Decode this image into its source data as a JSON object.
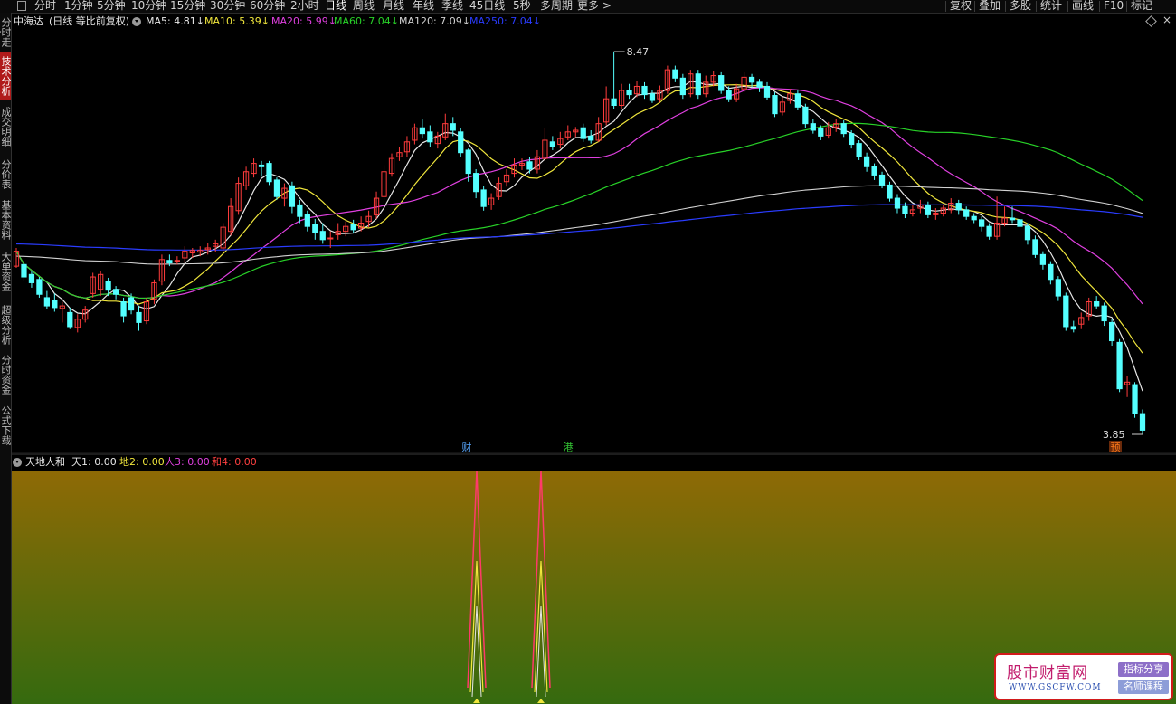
{
  "toolbar": {
    "timeframes": [
      "分时",
      "1分钟",
      "5分钟",
      "10分钟",
      "15分钟",
      "30分钟",
      "60分钟",
      "2小时",
      "日线",
      "周线",
      "月线",
      "年线",
      "季线",
      "45日线",
      "5秒",
      "多周期",
      "更多 >"
    ],
    "active": "日线",
    "right_buttons": [
      "复权",
      "叠加",
      "多股",
      "统计",
      "画线",
      "F10",
      "标记"
    ]
  },
  "left_tabs": [
    {
      "label": "分时走势",
      "selected": false
    },
    {
      "label": "技术分析",
      "selected": true
    },
    {
      "label": "成交明细",
      "selected": false
    },
    {
      "label": "分价表",
      "selected": false
    },
    {
      "label": "基本资料",
      "selected": false
    },
    {
      "label": "大单资金",
      "selected": false
    },
    {
      "label": "超级分析",
      "selected": false
    },
    {
      "label": "分时资金",
      "selected": false
    },
    {
      "label": "公式下载",
      "selected": false
    }
  ],
  "main_chart": {
    "stock": "中海达",
    "mode": "(日线 等比前复权)",
    "ma_legend": [
      {
        "label": "MA5: 4.81",
        "arrow": "↓",
        "color": "#e8e8e8"
      },
      {
        "label": "MA10: 5.39",
        "arrow": "↓",
        "color": "#f0e63c"
      },
      {
        "label": "MA20: 5.99",
        "arrow": "↓",
        "color": "#e040e0"
      },
      {
        "label": "MA60: 7.04",
        "arrow": "↓",
        "color": "#28d228"
      },
      {
        "label": "MA120: 7.09",
        "arrow": "↓",
        "color": "#d2d2d2"
      },
      {
        "label": "MA250: 7.04",
        "arrow": "↓",
        "color": "#2a3cff"
      }
    ],
    "high_label": "8.47",
    "low_label": "3.85",
    "markers": [
      {
        "text": "财",
        "color": "#58a8ff"
      },
      {
        "text": "港",
        "color": "#34c734"
      },
      {
        "text": "预",
        "color": "#ff7a1a"
      }
    ],
    "up_color": "#ff3c3c",
    "down_color": "#54ffff"
  },
  "indicator": {
    "name": "天地人和",
    "lines": [
      {
        "label": "天1: 0.00",
        "color": "#e8e8e8"
      },
      {
        "label": "地2: 0.00",
        "color": "#f0e63c"
      },
      {
        "label": "人3: 0.00",
        "color": "#e040e0"
      },
      {
        "label": "和4: 0.00",
        "color": "#ff4040"
      }
    ],
    "bg_top": "#8f6a05",
    "bg_bottom": "#356a0f",
    "spike_color": "#ff3a6a"
  },
  "watermark": {
    "main_text": "股市财富网",
    "url": "WWW.GSCFW.COM",
    "tag1": "指标分享",
    "tag2": "名师课程"
  },
  "chart_data": {
    "type": "candlestick",
    "price_range": [
      3.85,
      8.47
    ],
    "candles": [
      [
        5.88,
        6.06,
        6.1,
        5.86
      ],
      [
        5.9,
        5.75,
        5.95,
        5.7
      ],
      [
        5.78,
        5.68,
        5.82,
        5.62
      ],
      [
        5.72,
        5.54,
        5.75,
        5.5
      ],
      [
        5.5,
        5.4,
        5.58,
        5.36
      ],
      [
        5.47,
        5.38,
        5.55,
        5.33
      ],
      [
        5.37,
        5.4,
        5.45,
        5.2
      ],
      [
        5.32,
        5.15,
        5.38,
        5.12
      ],
      [
        5.14,
        5.24,
        5.3,
        5.08
      ],
      [
        5.24,
        5.35,
        5.4,
        5.2
      ],
      [
        5.55,
        5.75,
        5.8,
        5.5
      ],
      [
        5.6,
        5.78,
        5.82,
        5.52
      ],
      [
        5.7,
        5.59,
        5.74,
        5.52
      ],
      [
        5.6,
        5.54,
        5.64,
        5.48
      ],
      [
        5.45,
        5.28,
        5.5,
        5.2
      ],
      [
        5.5,
        5.35,
        5.55,
        5.3
      ],
      [
        5.32,
        5.2,
        5.4,
        5.1
      ],
      [
        5.22,
        5.45,
        5.5,
        5.18
      ],
      [
        5.48,
        5.68,
        5.72,
        5.42
      ],
      [
        5.7,
        5.96,
        6.02,
        5.65
      ],
      [
        5.95,
        5.92,
        6.02,
        5.88
      ],
      [
        5.94,
        5.95,
        6.0,
        5.9
      ],
      [
        5.98,
        6.06,
        6.12,
        5.92
      ],
      [
        6.04,
        6.07,
        6.1,
        5.98
      ],
      [
        6.05,
        6.07,
        6.12,
        6.0
      ],
      [
        6.08,
        6.1,
        6.16,
        6.02
      ],
      [
        6.12,
        6.15,
        6.2,
        6.05
      ],
      [
        6.1,
        6.35,
        6.4,
        6.05
      ],
      [
        6.3,
        6.6,
        6.7,
        6.25
      ],
      [
        6.55,
        6.88,
        6.95,
        6.5
      ],
      [
        6.85,
        7.02,
        7.08,
        6.8
      ],
      [
        7.0,
        7.12,
        7.18,
        6.95
      ],
      [
        7.1,
        7.08,
        7.15,
        6.96
      ],
      [
        7.12,
        6.9,
        7.15,
        6.86
      ],
      [
        6.92,
        6.72,
        6.95,
        6.68
      ],
      [
        6.7,
        6.82,
        6.88,
        6.6
      ],
      [
        6.85,
        6.6,
        6.9,
        6.52
      ],
      [
        6.62,
        6.48,
        6.68,
        6.4
      ],
      [
        6.5,
        6.36,
        6.55,
        6.3
      ],
      [
        6.38,
        6.28,
        6.45,
        6.2
      ],
      [
        6.3,
        6.2,
        6.4,
        6.15
      ],
      [
        6.22,
        6.22,
        6.3,
        6.1
      ],
      [
        6.26,
        6.3,
        6.4,
        6.2
      ],
      [
        6.3,
        6.36,
        6.42,
        6.24
      ],
      [
        6.38,
        6.32,
        6.44,
        6.28
      ],
      [
        6.34,
        6.4,
        6.48,
        6.3
      ],
      [
        6.42,
        6.48,
        6.55,
        6.35
      ],
      [
        6.5,
        6.7,
        6.78,
        6.45
      ],
      [
        6.72,
        7.02,
        7.1,
        6.68
      ],
      [
        7.0,
        7.18,
        7.24,
        6.96
      ],
      [
        7.2,
        7.25,
        7.32,
        7.15
      ],
      [
        7.26,
        7.38,
        7.45,
        7.2
      ],
      [
        7.4,
        7.55,
        7.6,
        7.35
      ],
      [
        7.55,
        7.48,
        7.65,
        7.42
      ],
      [
        7.5,
        7.38,
        7.58,
        7.32
      ],
      [
        7.36,
        7.45,
        7.5,
        7.3
      ],
      [
        7.44,
        7.6,
        7.72,
        7.4
      ],
      [
        7.6,
        7.52,
        7.68,
        7.45
      ],
      [
        7.5,
        7.25,
        7.55,
        7.2
      ],
      [
        7.28,
        7.0,
        7.3,
        6.9
      ],
      [
        7.0,
        6.78,
        7.05,
        6.7
      ],
      [
        6.8,
        6.6,
        6.85,
        6.55
      ],
      [
        6.62,
        6.7,
        6.76,
        6.56
      ],
      [
        6.72,
        6.88,
        6.95,
        6.68
      ],
      [
        6.9,
        6.98,
        7.05,
        6.84
      ],
      [
        7.0,
        7.1,
        7.18,
        6.95
      ],
      [
        7.1,
        7.12,
        7.18,
        7.04
      ],
      [
        7.14,
        7.05,
        7.2,
        7.0
      ],
      [
        7.05,
        7.2,
        7.28,
        7.0
      ],
      [
        7.18,
        7.4,
        7.55,
        7.15
      ],
      [
        7.38,
        7.32,
        7.45,
        7.28
      ],
      [
        7.35,
        7.42,
        7.5,
        7.3
      ],
      [
        7.44,
        7.5,
        7.58,
        7.4
      ],
      [
        7.5,
        7.52,
        7.56,
        7.44
      ],
      [
        7.55,
        7.42,
        7.6,
        7.38
      ],
      [
        7.45,
        7.4,
        7.52,
        7.36
      ],
      [
        7.4,
        7.6,
        7.68,
        7.38
      ],
      [
        7.62,
        7.9,
        8.05,
        7.58
      ],
      [
        7.9,
        7.82,
        8.47,
        7.78
      ],
      [
        7.82,
        8.0,
        8.08,
        7.78
      ],
      [
        8.0,
        7.95,
        8.08,
        7.9
      ],
      [
        7.96,
        8.05,
        8.12,
        7.92
      ],
      [
        8.05,
        7.95,
        8.1,
        7.9
      ],
      [
        7.96,
        7.88,
        8.0,
        7.85
      ],
      [
        7.9,
        8.0,
        8.06,
        7.86
      ],
      [
        8.0,
        8.25,
        8.3,
        7.96
      ],
      [
        8.25,
        8.15,
        8.3,
        8.1
      ],
      [
        8.15,
        7.95,
        8.2,
        7.9
      ],
      [
        7.96,
        8.2,
        8.25,
        7.92
      ],
      [
        8.2,
        7.95,
        8.25,
        7.9
      ],
      [
        7.96,
        8.1,
        8.18,
        7.92
      ],
      [
        8.1,
        8.18,
        8.24,
        8.05
      ],
      [
        8.18,
        8.0,
        8.22,
        7.96
      ],
      [
        8.0,
        7.9,
        8.05,
        7.86
      ],
      [
        7.9,
        8.02,
        8.08,
        7.86
      ],
      [
        8.02,
        8.16,
        8.22,
        7.98
      ],
      [
        8.16,
        8.1,
        8.2,
        8.04
      ],
      [
        8.1,
        8.04,
        8.14,
        7.98
      ],
      [
        8.05,
        7.92,
        8.1,
        7.88
      ],
      [
        7.94,
        7.72,
        7.98,
        7.68
      ],
      [
        7.74,
        7.86,
        7.92,
        7.7
      ],
      [
        7.88,
        7.96,
        8.02,
        7.84
      ],
      [
        7.96,
        7.8,
        8.0,
        7.76
      ],
      [
        7.8,
        7.6,
        7.84,
        7.55
      ],
      [
        7.6,
        7.52,
        7.66,
        7.48
      ],
      [
        7.54,
        7.45,
        7.58,
        7.4
      ],
      [
        7.46,
        7.55,
        7.62,
        7.42
      ],
      [
        7.56,
        7.6,
        7.66,
        7.5
      ],
      [
        7.6,
        7.48,
        7.64,
        7.44
      ],
      [
        7.48,
        7.35,
        7.52,
        7.3
      ],
      [
        7.36,
        7.2,
        7.4,
        7.16
      ],
      [
        7.2,
        7.08,
        7.25,
        7.02
      ],
      [
        7.08,
        6.98,
        7.12,
        6.92
      ],
      [
        6.98,
        6.86,
        7.02,
        6.82
      ],
      [
        6.86,
        6.7,
        6.9,
        6.66
      ],
      [
        6.7,
        6.58,
        6.75,
        6.52
      ],
      [
        6.6,
        6.52,
        6.65,
        6.46
      ],
      [
        6.52,
        6.56,
        6.62,
        6.48
      ],
      [
        6.58,
        6.62,
        6.68,
        6.52
      ],
      [
        6.62,
        6.5,
        6.66,
        6.46
      ],
      [
        6.5,
        6.52,
        6.58,
        6.44
      ],
      [
        6.52,
        6.58,
        6.62,
        6.48
      ],
      [
        6.56,
        6.64,
        6.7,
        6.52
      ],
      [
        6.64,
        6.56,
        6.68,
        6.5
      ],
      [
        6.56,
        6.48,
        6.6,
        6.44
      ],
      [
        6.48,
        6.44,
        6.52,
        6.4
      ],
      [
        6.44,
        6.36,
        6.48,
        6.3
      ],
      [
        6.36,
        6.24,
        6.4,
        6.2
      ],
      [
        6.24,
        6.4,
        6.72,
        6.2
      ],
      [
        6.4,
        6.46,
        6.6,
        6.36
      ],
      [
        6.46,
        6.44,
        6.6,
        6.4
      ],
      [
        6.44,
        6.36,
        6.5,
        6.3
      ],
      [
        6.36,
        6.2,
        6.4,
        6.14
      ],
      [
        6.2,
        6.02,
        6.25,
        5.98
      ],
      [
        6.02,
        5.9,
        6.06,
        5.84
      ],
      [
        5.9,
        5.72,
        5.94,
        5.66
      ],
      [
        5.72,
        5.52,
        5.76,
        5.46
      ],
      [
        5.52,
        5.15,
        5.56,
        5.1
      ],
      [
        5.15,
        5.12,
        5.22,
        5.08
      ],
      [
        5.18,
        5.26,
        5.32,
        5.12
      ],
      [
        5.28,
        5.45,
        5.5,
        5.22
      ],
      [
        5.45,
        5.4,
        5.52,
        5.36
      ],
      [
        5.4,
        5.22,
        5.44,
        5.16
      ],
      [
        5.2,
        4.98,
        5.24,
        4.92
      ],
      [
        4.96,
        4.4,
        5.0,
        4.36
      ],
      [
        4.45,
        4.48,
        4.55,
        4.3
      ],
      [
        4.45,
        4.1,
        4.48,
        4.05
      ],
      [
        4.1,
        3.9,
        4.15,
        3.85
      ]
    ]
  }
}
